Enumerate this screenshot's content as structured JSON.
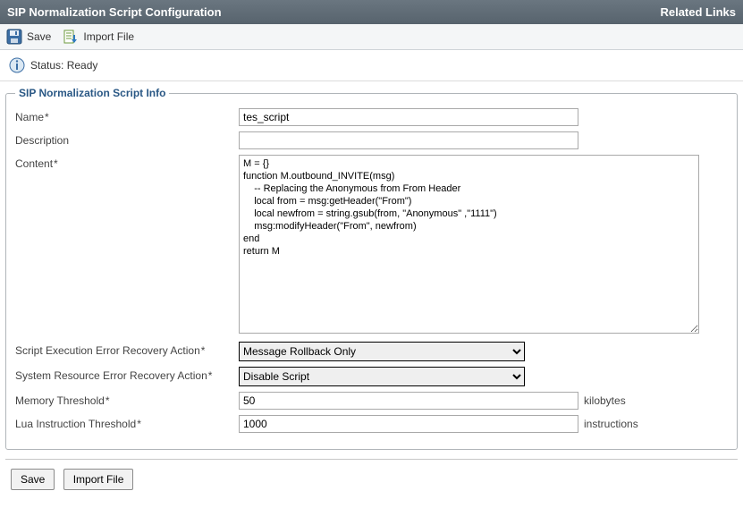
{
  "header": {
    "title": "SIP Normalization Script Configuration",
    "related_links": "Related Links"
  },
  "toolbar": {
    "save_label": "Save",
    "import_label": "Import File"
  },
  "status": {
    "label_prefix": "Status:",
    "value": "Ready"
  },
  "section": {
    "legend": "SIP Normalization Script Info"
  },
  "form": {
    "name": {
      "label": "Name",
      "value": "tes_script"
    },
    "description": {
      "label": "Description",
      "value": ""
    },
    "content": {
      "label": "Content",
      "value": "M = {}\nfunction M.outbound_INVITE(msg)\n    -- Replacing the Anonymous from From Header\n    local from = msg:getHeader(\"From\")\n    local newfrom = string.gsub(from, \"Anonymous\" ,\"1111\")\n    msg:modifyHeader(\"From\", newfrom)\nend\nreturn M"
    },
    "script_err_action": {
      "label": "Script Execution Error Recovery Action",
      "value": "Message Rollback Only"
    },
    "sys_err_action": {
      "label": "System Resource Error Recovery Action",
      "value": "Disable Script"
    },
    "memory_threshold": {
      "label": "Memory Threshold",
      "value": "50",
      "unit": "kilobytes"
    },
    "lua_threshold": {
      "label": "Lua Instruction Threshold",
      "value": "1000",
      "unit": "instructions"
    }
  },
  "footer": {
    "save_label": "Save",
    "import_label": "Import File"
  }
}
